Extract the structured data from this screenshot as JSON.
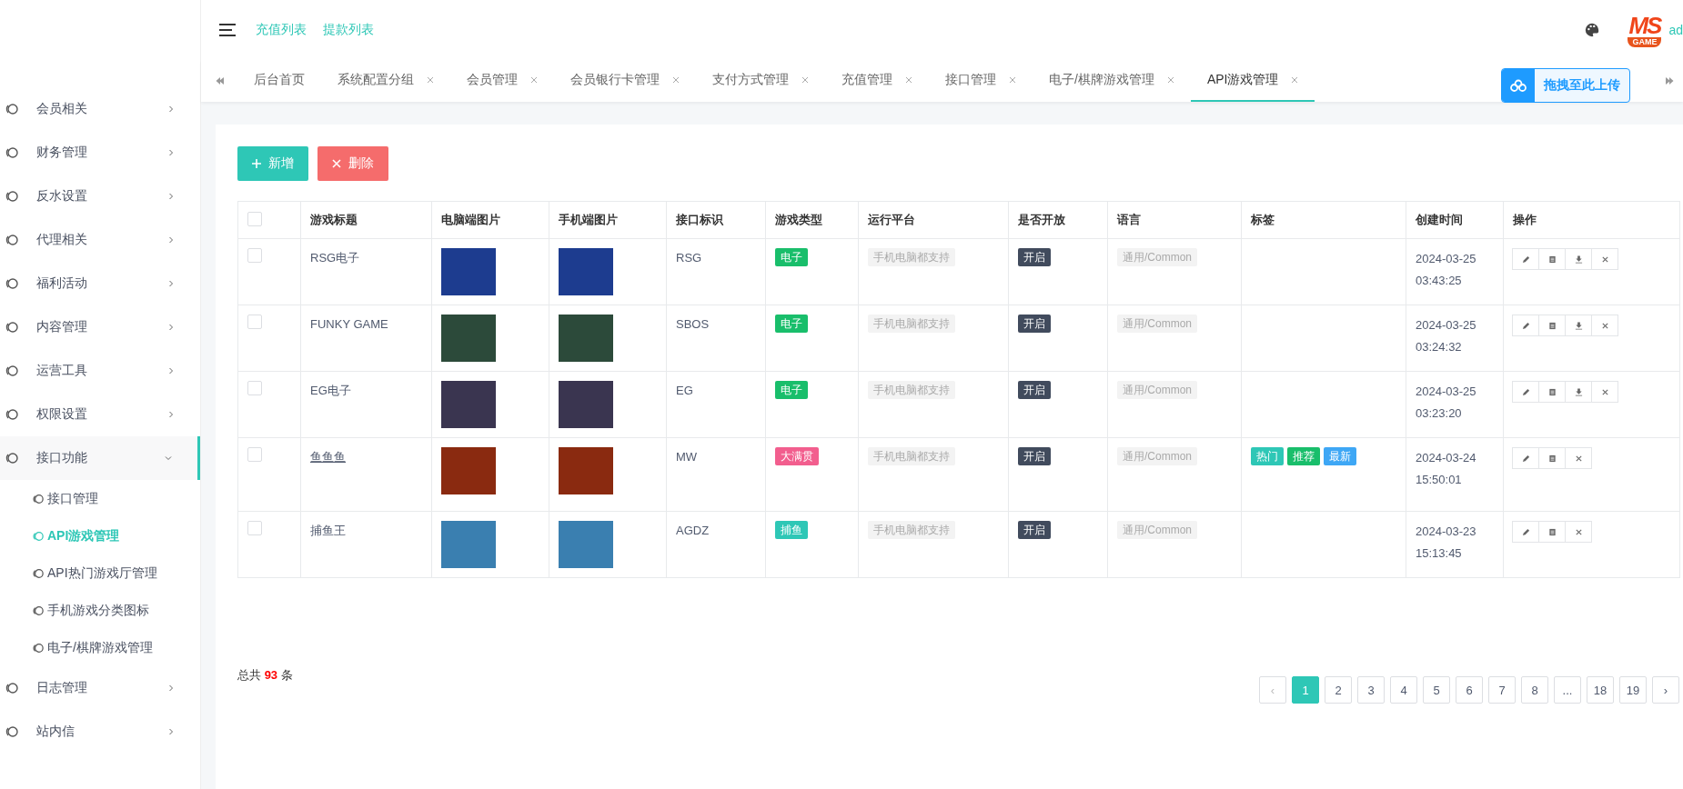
{
  "header": {
    "links": [
      "充值列表",
      "提款列表"
    ],
    "logo": {
      "top": "MS",
      "bottom": "GAME"
    },
    "user": "ad"
  },
  "sidebar": {
    "items": [
      {
        "label": "会员相关",
        "expanded": false
      },
      {
        "label": "财务管理",
        "expanded": false
      },
      {
        "label": "反水设置",
        "expanded": false
      },
      {
        "label": "代理相关",
        "expanded": false
      },
      {
        "label": "福利活动",
        "expanded": false
      },
      {
        "label": "内容管理",
        "expanded": false
      },
      {
        "label": "运营工具",
        "expanded": false
      },
      {
        "label": "权限设置",
        "expanded": false
      },
      {
        "label": "接口功能",
        "expanded": true,
        "children": [
          {
            "label": "接口管理",
            "selected": false
          },
          {
            "label": "API游戏管理",
            "selected": true
          },
          {
            "label": "API热门游戏厅管理",
            "selected": false
          },
          {
            "label": "手机游戏分类图标",
            "selected": false
          },
          {
            "label": "电子/棋牌游戏管理",
            "selected": false
          }
        ]
      },
      {
        "label": "日志管理",
        "expanded": false
      },
      {
        "label": "站内信",
        "expanded": false
      }
    ]
  },
  "tabs": [
    {
      "label": "后台首页",
      "selected": false,
      "closable": false
    },
    {
      "label": "系统配置分组",
      "selected": false,
      "closable": true
    },
    {
      "label": "会员管理",
      "selected": false,
      "closable": true
    },
    {
      "label": "会员银行卡管理",
      "selected": false,
      "closable": true
    },
    {
      "label": "支付方式管理",
      "selected": false,
      "closable": true
    },
    {
      "label": "充值管理",
      "selected": false,
      "closable": true
    },
    {
      "label": "接口管理",
      "selected": false,
      "closable": true
    },
    {
      "label": "电子/棋牌游戏管理",
      "selected": false,
      "closable": true
    },
    {
      "label": "API游戏管理",
      "selected": true,
      "closable": true
    }
  ],
  "upload_button": "拖拽至此上传",
  "toolbar": {
    "add": "新增",
    "delete": "删除"
  },
  "table": {
    "select_all_checked": false,
    "columns": [
      "游戏标题",
      "电脑端图片",
      "手机端图片",
      "接口标识",
      "游戏类型",
      "运行平台",
      "是否开放",
      "语言",
      "标签",
      "创建时间",
      "操作"
    ],
    "rows": [
      {
        "checked": false,
        "title": "RSG电子",
        "code": "RSG",
        "type": {
          "label": "电子",
          "color": "#19be6b"
        },
        "platform": "手机电脑都支持",
        "open": "开启",
        "language": "通用/Common",
        "tags": [],
        "date": "2024-03-25",
        "time": "03:43:25",
        "actions": [
          {
            "kind": "edit"
          },
          {
            "kind": "detail"
          },
          {
            "kind": "download"
          },
          {
            "kind": "delete"
          }
        ]
      },
      {
        "checked": false,
        "title": "FUNKY GAME",
        "code": "SBOS",
        "type": {
          "label": "电子",
          "color": "#19be6b"
        },
        "platform": "手机电脑都支持",
        "open": "开启",
        "language": "通用/Common",
        "tags": [],
        "date": "2024-03-25",
        "time": "03:24:32",
        "actions": [
          {
            "kind": "edit"
          },
          {
            "kind": "detail"
          },
          {
            "kind": "download"
          },
          {
            "kind": "delete"
          }
        ]
      },
      {
        "checked": false,
        "title": "EG电子",
        "code": "EG",
        "type": {
          "label": "电子",
          "color": "#19be6b"
        },
        "platform": "手机电脑都支持",
        "open": "开启",
        "language": "通用/Common",
        "tags": [],
        "date": "2024-03-25",
        "time": "03:23:20",
        "actions": [
          {
            "kind": "edit"
          },
          {
            "kind": "detail"
          },
          {
            "kind": "download"
          },
          {
            "kind": "delete"
          }
        ]
      },
      {
        "checked": false,
        "title": "鱼鱼鱼",
        "code": "MW",
        "type": {
          "label": "大满贯",
          "color": "#f25e8e"
        },
        "platform": "手机电脑都支持",
        "open": "开启",
        "language": "通用/Common",
        "tags": [
          {
            "label": "热门",
            "color": "#2ec7b6"
          },
          {
            "label": "推荐",
            "color": "#19be6b"
          },
          {
            "label": "最新",
            "color": "#3ea7f5"
          }
        ],
        "date": "2024-03-24",
        "time": "15:50:01",
        "actions": [
          {
            "kind": "edit"
          },
          {
            "kind": "detail"
          },
          {
            "kind": "delete"
          }
        ]
      },
      {
        "checked": false,
        "title": "捕鱼王",
        "code": "AGDZ",
        "type": {
          "label": "捕鱼",
          "color": "#2ec7b6"
        },
        "platform": "手机电脑都支持",
        "open": "开启",
        "language": "通用/Common",
        "tags": [],
        "date": "2024-03-23",
        "time": "15:13:45",
        "actions": [
          {
            "kind": "edit"
          },
          {
            "kind": "detail"
          },
          {
            "kind": "delete"
          }
        ]
      }
    ]
  },
  "footer": {
    "total": "总共 **93** 条"
  },
  "pagination": {
    "prev": "‹",
    "next": "›",
    "pages": [
      {
        "label": "1",
        "selected": true
      },
      {
        "label": "2",
        "selected": false
      },
      {
        "label": "3",
        "selected": false
      },
      {
        "label": "4",
        "selected": false
      },
      {
        "label": "5",
        "selected": false
      },
      {
        "label": "6",
        "selected": false
      },
      {
        "label": "7",
        "selected": false
      },
      {
        "label": "8",
        "selected": false
      },
      {
        "label": "...",
        "selected": false
      },
      {
        "label": "18",
        "selected": false
      },
      {
        "label": "19",
        "selected": false
      }
    ]
  }
}
